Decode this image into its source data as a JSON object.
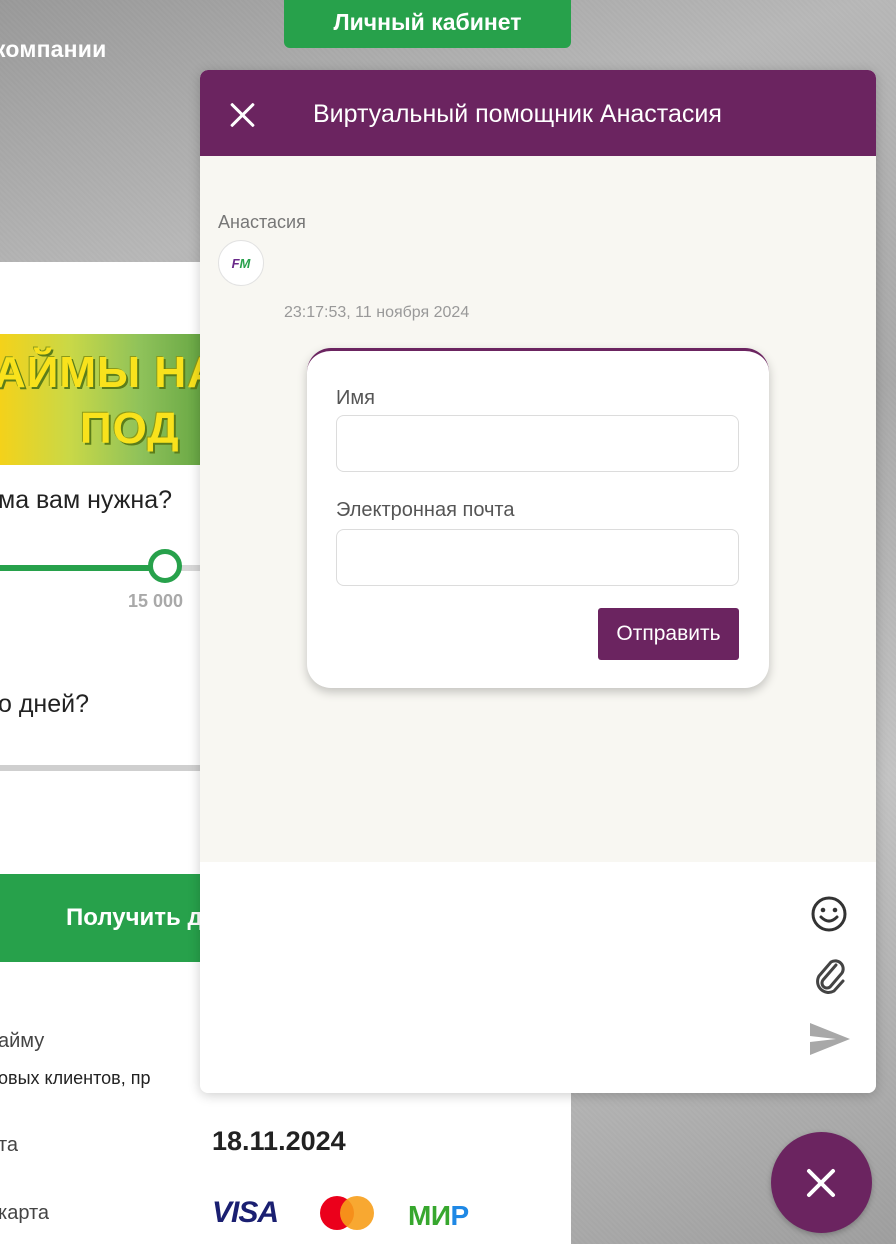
{
  "page": {
    "top_link": "компании",
    "cabinet_button": "Личный кабинет",
    "banner": {
      "line1": "АЙМЫ НА",
      "line2": "ПОД "
    },
    "question_amount": "ма вам нужна?",
    "slider_value_label": "15 000",
    "question_days": "о дней?",
    "get_button": "Получить д",
    "info_line1": "айму",
    "info_line2": "овых клиентов, пр",
    "info_line3": "та",
    "date_value": "18.11.2024",
    "info_line4": "карта",
    "payment_logos": {
      "visa": "VISA",
      "mir_1": "МИ",
      "mir_2": "Р"
    }
  },
  "chat": {
    "title": "Виртуальный помощник Анастасия",
    "sender_name": "Анастасия",
    "avatar_text": {
      "part1": "F",
      "part2": "M"
    },
    "timestamp": "23:17:53, 11 ноября 2024",
    "form": {
      "name_label": "Имя",
      "name_value": "",
      "email_label": "Электронная почта",
      "email_value": "",
      "submit_label": "Отправить"
    },
    "message_input": {
      "value": "",
      "placeholder": ""
    },
    "icons": [
      "close-icon",
      "smile-icon",
      "paperclip-icon",
      "send-icon",
      "fab-close-icon"
    ]
  },
  "colors": {
    "brand_purple": "#6b2460",
    "brand_green": "#27a14b",
    "chat_background": "#f8f7f2"
  }
}
